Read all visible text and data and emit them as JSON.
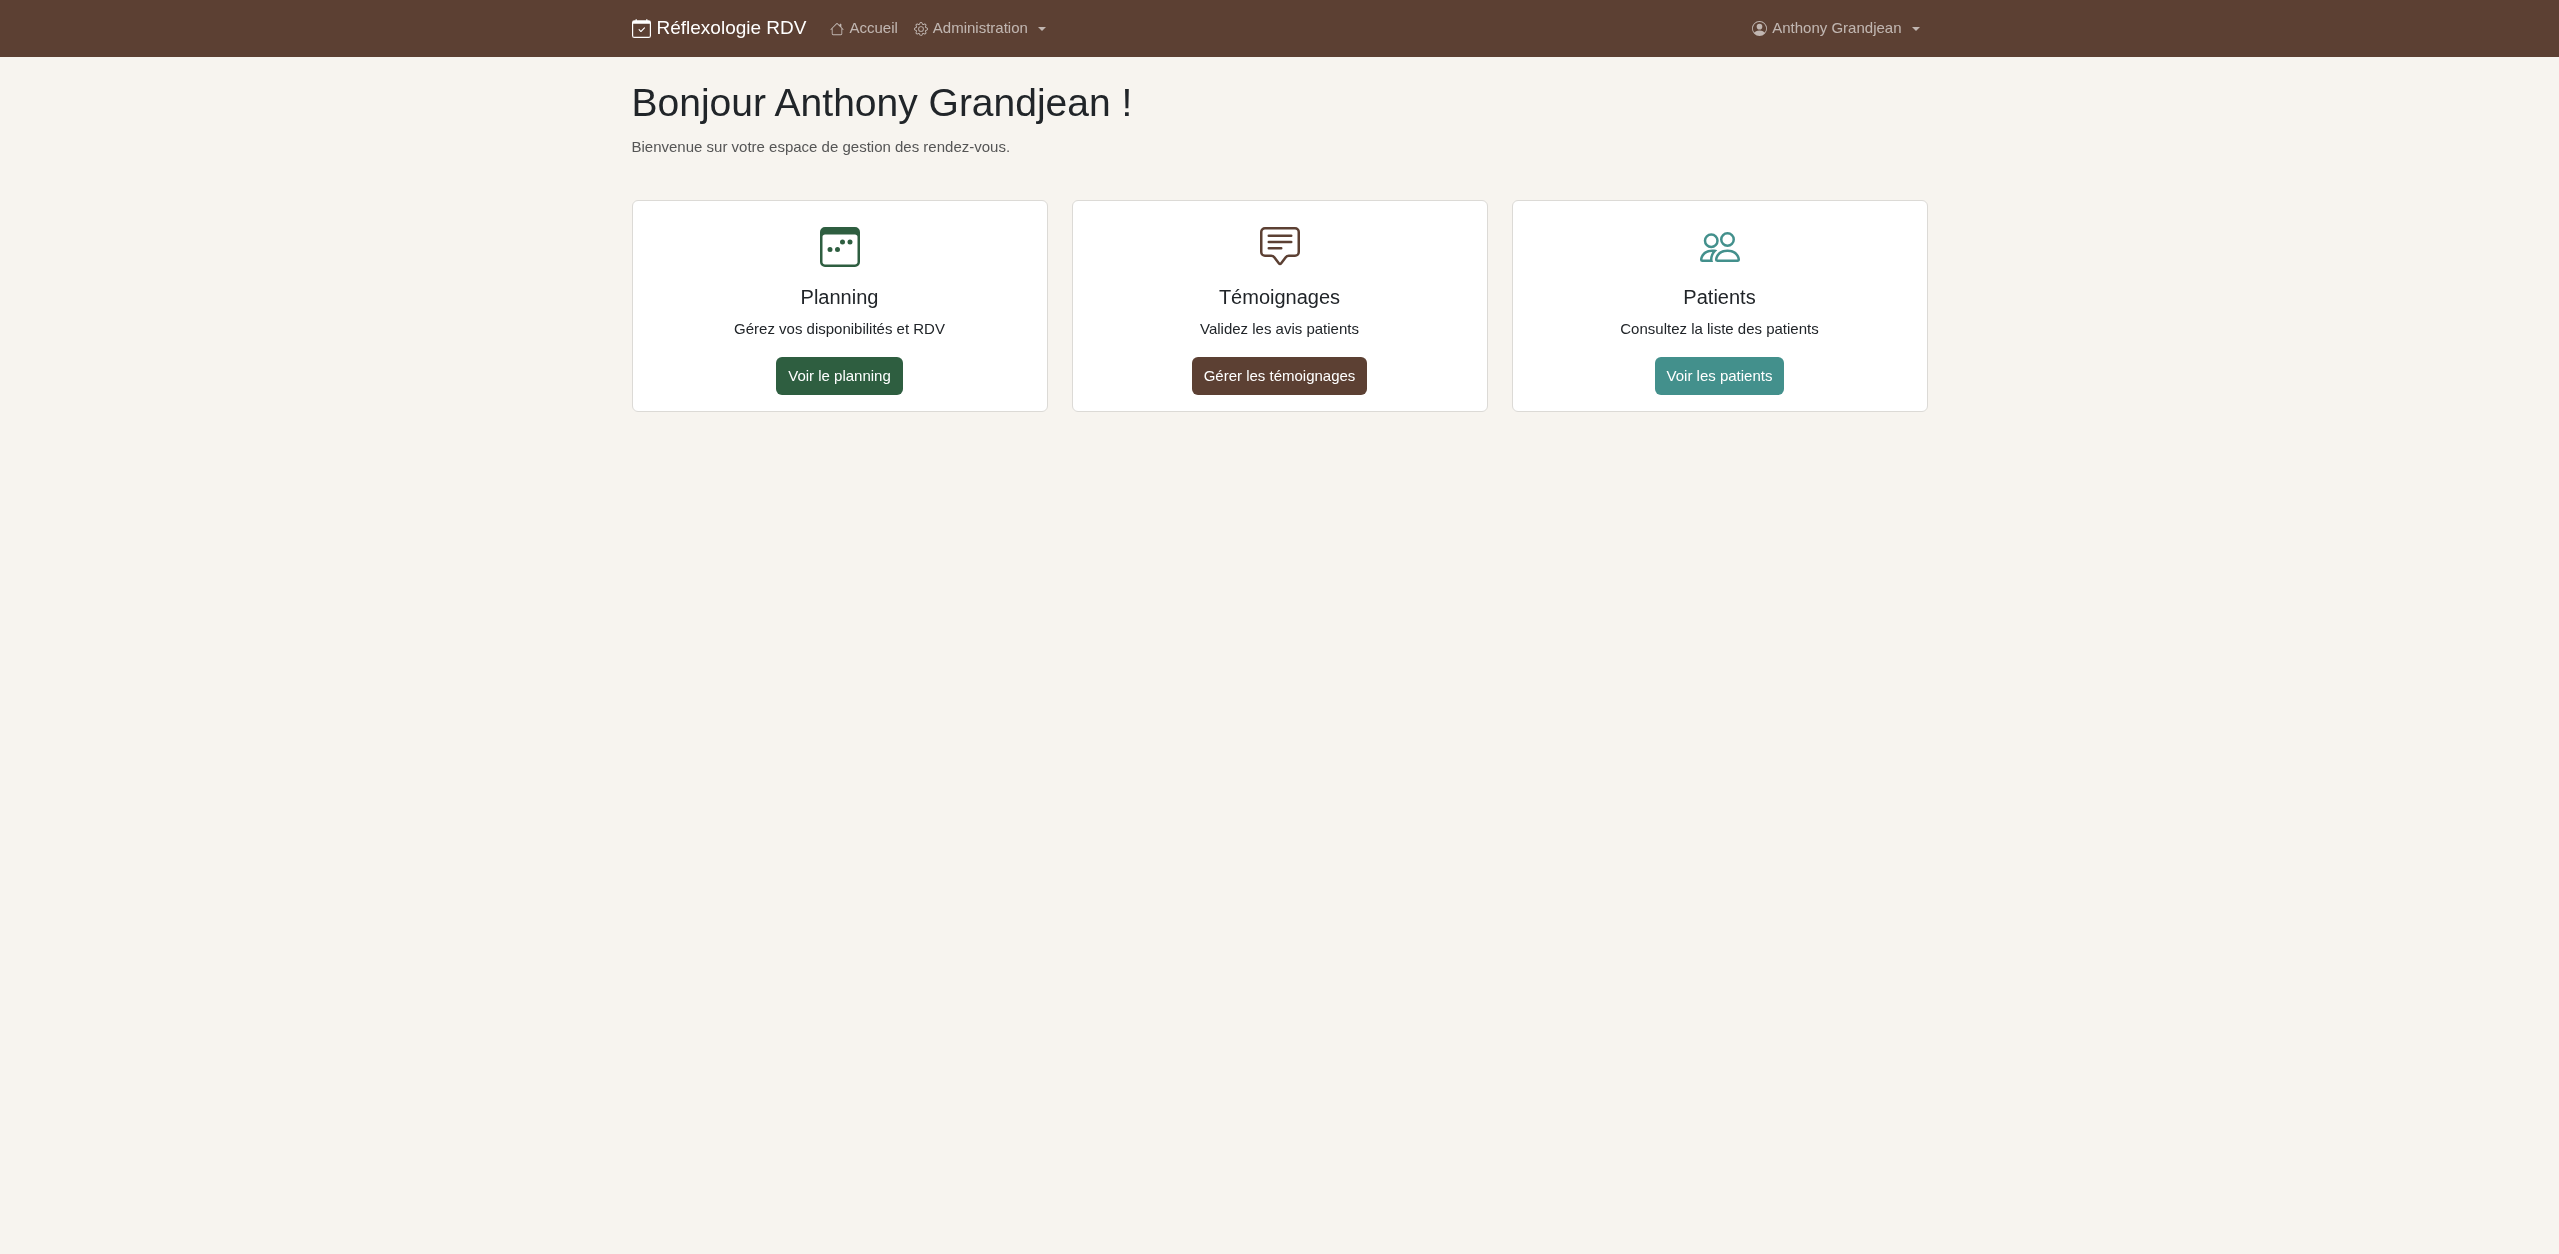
{
  "navbar": {
    "brand": "Réflexologie RDV",
    "links": [
      {
        "label": "Accueil",
        "dropdown": false
      },
      {
        "label": "Administration",
        "dropdown": true
      }
    ],
    "user_menu": {
      "label": "Anthony Grandjean",
      "dropdown": true
    }
  },
  "greeting": {
    "title": "Bonjour Anthony Grandjean !",
    "subtitle": "Bienvenue sur votre espace de gestion des rendez-vous."
  },
  "cards": [
    {
      "title": "Planning",
      "description": "Gérez vos disponibilités et RDV",
      "button": "Voir le planning",
      "color": "#2e5e40"
    },
    {
      "title": "Témoignages",
      "description": "Validez les avis patients",
      "button": "Gérer les témoignages",
      "color": "#5c4033"
    },
    {
      "title": "Patients",
      "description": "Consultez la liste des patients",
      "button": "Voir les patients",
      "color": "#43908c"
    }
  ]
}
